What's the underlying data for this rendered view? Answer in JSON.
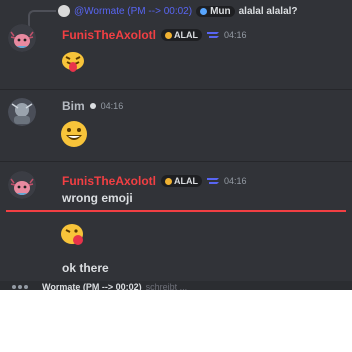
{
  "reply": {
    "author": "@Wormate (PM --> 00:02)",
    "tag": "Mun",
    "text": "alalal alalal?"
  },
  "messages": [
    {
      "author": "FunisTheAxolotl",
      "badge": "ALAL",
      "time": "04:16",
      "emoji": "tongue-face-emoji"
    },
    {
      "author": "Bim",
      "time": "04:16",
      "emoji": "grinning-face-emoji"
    },
    {
      "author": "FunisTheAxolotl",
      "badge": "ALAL",
      "time": "04:16",
      "text": "wrong emoji"
    },
    {
      "emoji": "tongue-face-side-emoji"
    },
    {
      "text": "ok there"
    }
  ],
  "bottom": {
    "name": "Wormate (PM --> 00:02)",
    "rest": "schreibt ..."
  },
  "colors": {
    "background": "#313338",
    "accent_red": "#f23f43",
    "muted": "#949ba4",
    "text": "#dbdee1"
  }
}
